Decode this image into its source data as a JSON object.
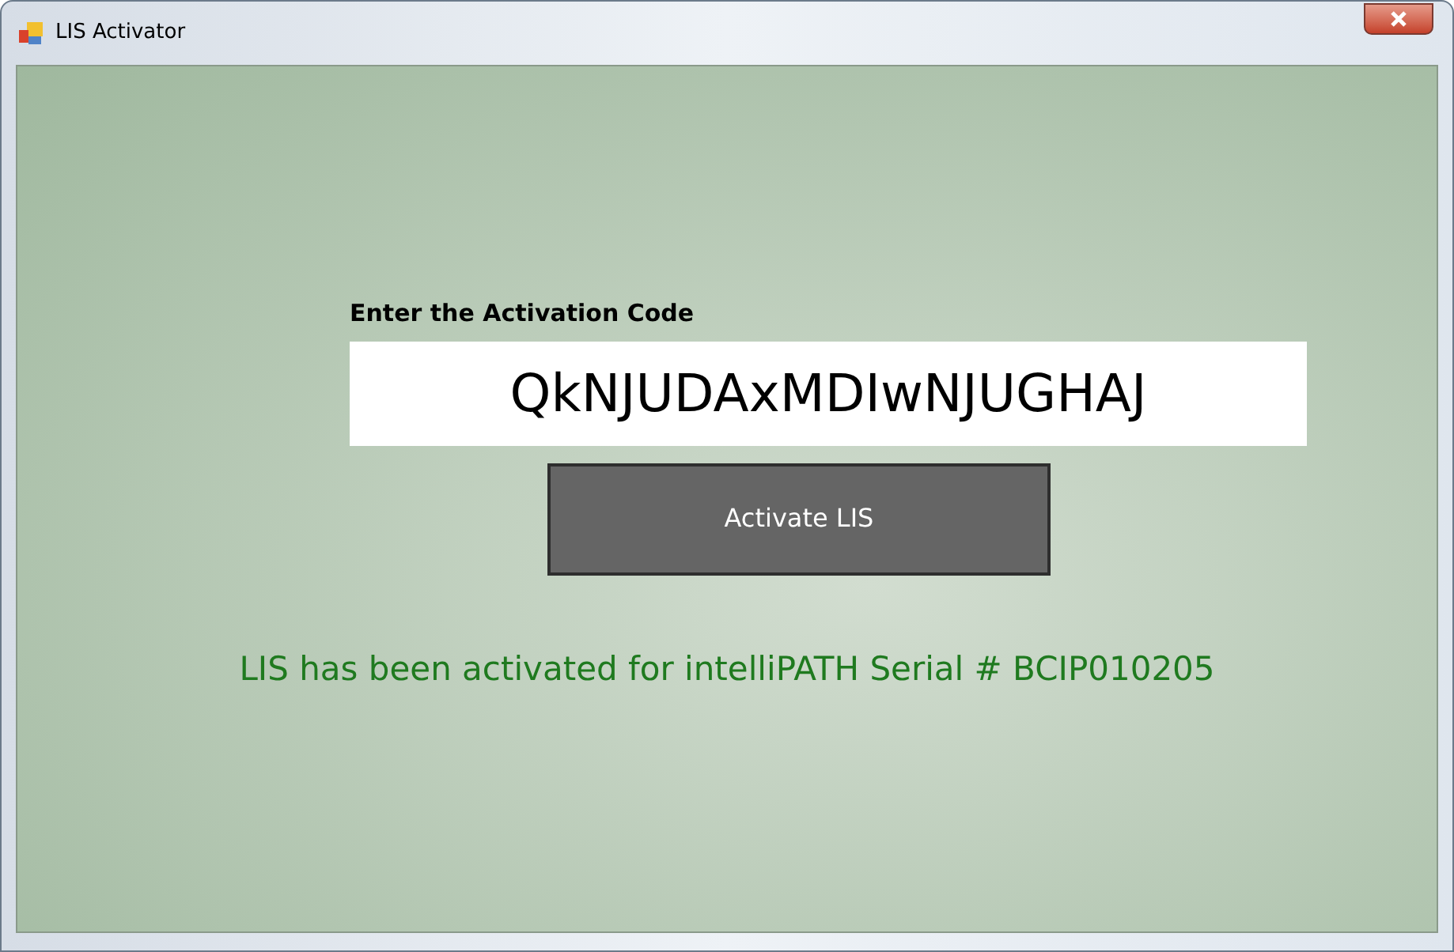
{
  "window": {
    "title": "LIS Activator"
  },
  "form": {
    "label": "Enter the Activation Code",
    "code": {
      "value": "QkNJUDAxMDIwNJUGHAJ"
    },
    "button": "Activate LIS",
    "status": "LIS has been activated for intelliPATH Serial # BCIP010205"
  }
}
